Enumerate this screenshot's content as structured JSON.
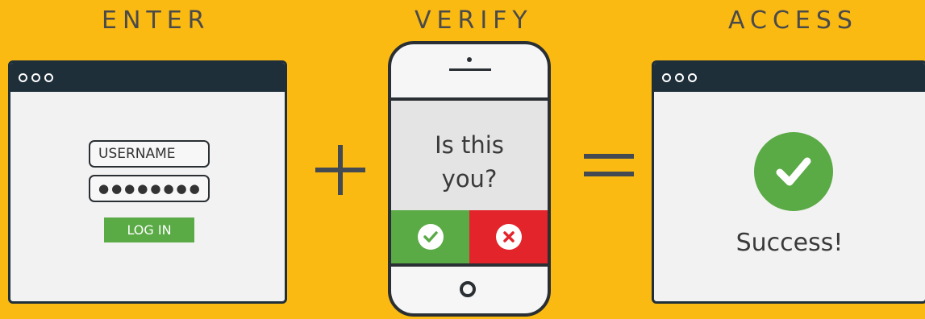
{
  "steps": {
    "enter": "ENTER",
    "verify": "VERIFY",
    "access": "ACCESS"
  },
  "login_form": {
    "username_placeholder": "USERNAME",
    "password_value": "●●●●●●●●",
    "login_label": "LOG IN"
  },
  "phone": {
    "prompt_line1": "Is this",
    "prompt_line2": "you?"
  },
  "result": {
    "message": "Success!"
  },
  "icons": {
    "operator_plus": "plus-icon",
    "operator_equals": "equals-icon",
    "approve": "check-icon",
    "deny": "x-icon",
    "success": "check-circle-icon"
  },
  "colors": {
    "background": "#FBBA12",
    "dark": "#1f2f3a",
    "green": "#5aaa46",
    "red": "#e3242b"
  }
}
